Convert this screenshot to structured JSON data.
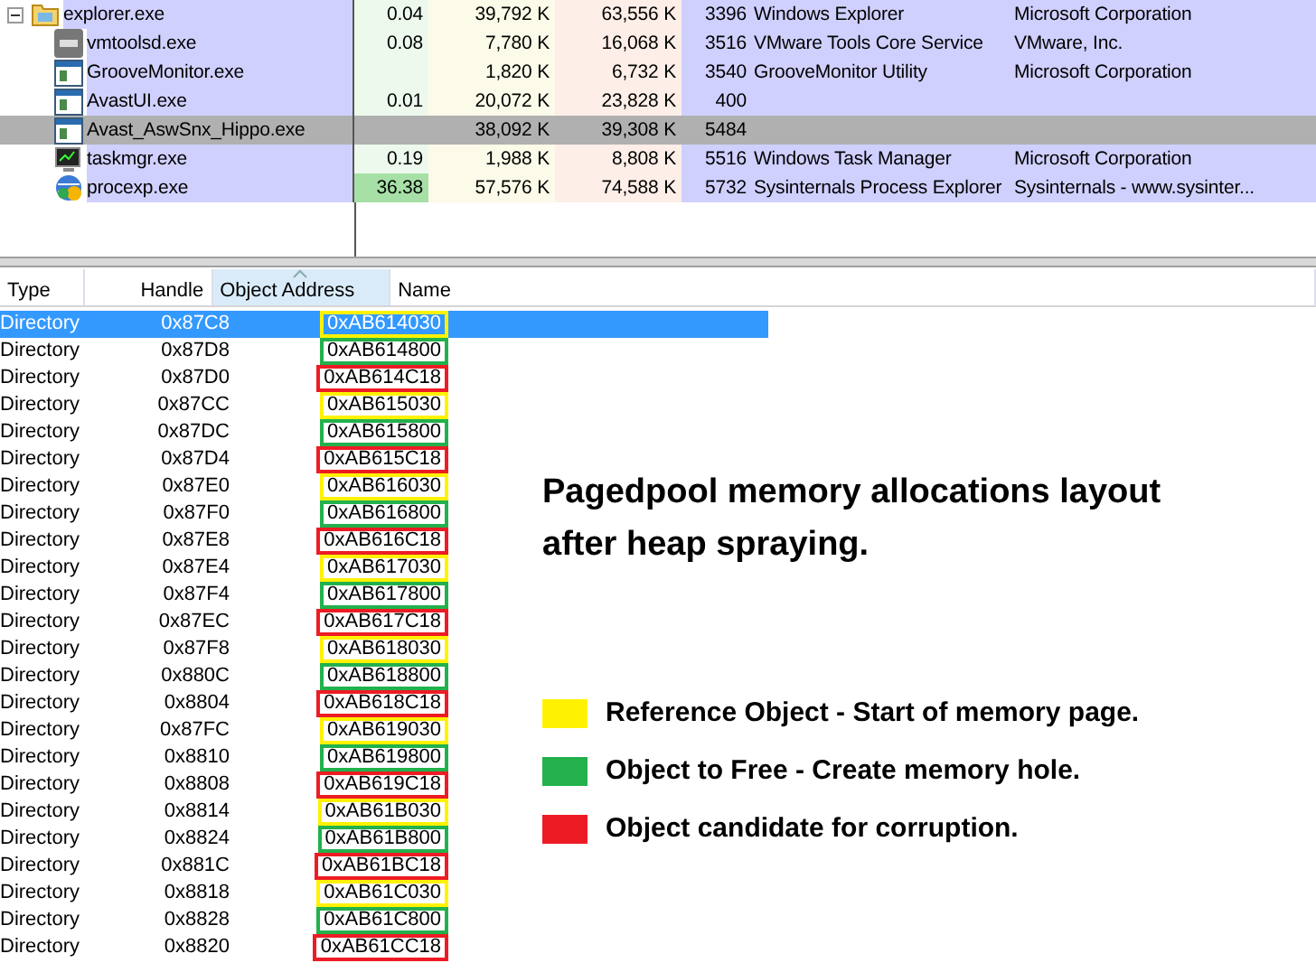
{
  "processes": [
    {
      "name": "explorer.exe",
      "kind": "folder",
      "expanded": true,
      "selected": false,
      "busy": false,
      "cells": [
        "0.04",
        "39,792 K",
        "63,556 K",
        "3396",
        "Windows Explorer",
        "Microsoft Corporation"
      ],
      "children": [
        {
          "name": "vmtoolsd.exe",
          "kind": "vm",
          "selected": false,
          "busy": false,
          "cells": [
            "0.08",
            "7,780 K",
            "16,068 K",
            "3516",
            "VMware Tools Core Service",
            "VMware, Inc."
          ]
        },
        {
          "name": "GrooveMonitor.exe",
          "kind": "window",
          "selected": false,
          "busy": false,
          "cells": [
            null,
            "1,820 K",
            "6,732 K",
            "3540",
            "GrooveMonitor Utility",
            "Microsoft Corporation"
          ]
        },
        {
          "name": "AvastUI.exe",
          "kind": "window",
          "selected": false,
          "busy": false,
          "cells": [
            "0.01",
            "20,072 K",
            "23,828 K",
            "400",
            null,
            null
          ]
        },
        {
          "name": "Avast_AswSnx_Hippo.exe",
          "kind": "window",
          "selected": true,
          "busy": false,
          "cells": [
            null,
            "38,092 K",
            "39,308 K",
            "5484",
            null,
            null
          ]
        },
        {
          "name": "taskmgr.exe",
          "kind": "monitor",
          "selected": false,
          "busy": false,
          "cells": [
            "0.19",
            "1,988 K",
            "8,808 K",
            "5516",
            "Windows Task Manager",
            "Microsoft Corporation"
          ]
        },
        {
          "name": "procexp.exe",
          "kind": "globe",
          "selected": false,
          "busy": true,
          "cells": [
            "36.38",
            "57,576 K",
            "74,588 K",
            "5732",
            "Sysinternals Process Explorer",
            "Sysinternals - www.sysinter..."
          ]
        }
      ]
    }
  ],
  "handles_table": {
    "columns": [
      {
        "label": "Type",
        "sorted": false
      },
      {
        "label": "Handle",
        "sorted": false
      },
      {
        "label": "Object Address",
        "sorted": true
      },
      {
        "label": "Name",
        "sorted": false
      }
    ],
    "rows": [
      {
        "type": "Directory",
        "handle": "0x87C8",
        "address": "0xAB614030",
        "color": "#fff200",
        "selected": true
      },
      {
        "type": "Directory",
        "handle": "0x87D8",
        "address": "0xAB614800",
        "color": "#22b14c",
        "selected": false
      },
      {
        "type": "Directory",
        "handle": "0x87D0",
        "address": "0xAB614C18",
        "color": "#ed1c24",
        "selected": false
      },
      {
        "type": "Directory",
        "handle": "0x87CC",
        "address": "0xAB615030",
        "color": "#fff200",
        "selected": false
      },
      {
        "type": "Directory",
        "handle": "0x87DC",
        "address": "0xAB615800",
        "color": "#22b14c",
        "selected": false
      },
      {
        "type": "Directory",
        "handle": "0x87D4",
        "address": "0xAB615C18",
        "color": "#ed1c24",
        "selected": false
      },
      {
        "type": "Directory",
        "handle": "0x87E0",
        "address": "0xAB616030",
        "color": "#fff200",
        "selected": false
      },
      {
        "type": "Directory",
        "handle": "0x87F0",
        "address": "0xAB616800",
        "color": "#22b14c",
        "selected": false
      },
      {
        "type": "Directory",
        "handle": "0x87E8",
        "address": "0xAB616C18",
        "color": "#ed1c24",
        "selected": false
      },
      {
        "type": "Directory",
        "handle": "0x87E4",
        "address": "0xAB617030",
        "color": "#fff200",
        "selected": false
      },
      {
        "type": "Directory",
        "handle": "0x87F4",
        "address": "0xAB617800",
        "color": "#22b14c",
        "selected": false
      },
      {
        "type": "Directory",
        "handle": "0x87EC",
        "address": "0xAB617C18",
        "color": "#ed1c24",
        "selected": false
      },
      {
        "type": "Directory",
        "handle": "0x87F8",
        "address": "0xAB618030",
        "color": "#fff200",
        "selected": false
      },
      {
        "type": "Directory",
        "handle": "0x880C",
        "address": "0xAB618800",
        "color": "#22b14c",
        "selected": false
      },
      {
        "type": "Directory",
        "handle": "0x8804",
        "address": "0xAB618C18",
        "color": "#ed1c24",
        "selected": false
      },
      {
        "type": "Directory",
        "handle": "0x87FC",
        "address": "0xAB619030",
        "color": "#fff200",
        "selected": false
      },
      {
        "type": "Directory",
        "handle": "0x8810",
        "address": "0xAB619800",
        "color": "#22b14c",
        "selected": false
      },
      {
        "type": "Directory",
        "handle": "0x8808",
        "address": "0xAB619C18",
        "color": "#ed1c24",
        "selected": false
      },
      {
        "type": "Directory",
        "handle": "0x8814",
        "address": "0xAB61B030",
        "color": "#fff200",
        "selected": false
      },
      {
        "type": "Directory",
        "handle": "0x8824",
        "address": "0xAB61B800",
        "color": "#22b14c",
        "selected": false
      },
      {
        "type": "Directory",
        "handle": "0x881C",
        "address": "0xAB61BC18",
        "color": "#ed1c24",
        "selected": false
      },
      {
        "type": "Directory",
        "handle": "0x8818",
        "address": "0xAB61C030",
        "color": "#fff200",
        "selected": false
      },
      {
        "type": "Directory",
        "handle": "0x8828",
        "address": "0xAB61C800",
        "color": "#22b14c",
        "selected": false
      },
      {
        "type": "Directory",
        "handle": "0x8820",
        "address": "0xAB61CC18",
        "color": "#ed1c24",
        "selected": false
      }
    ]
  },
  "annotation": {
    "title": "Pagedpool memory allocations layout after heap spraying.",
    "legend": [
      {
        "label": "Reference Object - Start of memory page.",
        "color": "#fff200"
      },
      {
        "label": "Object to Free - Create memory hole.",
        "color": "#22b14c"
      },
      {
        "label": "Object candidate for corruption.",
        "color": "#ed1c24"
      }
    ]
  }
}
